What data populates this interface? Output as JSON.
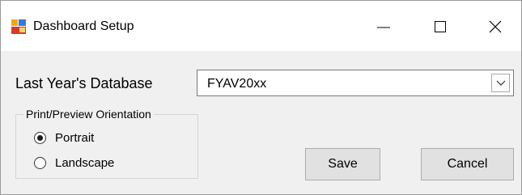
{
  "window": {
    "title": "Dashboard Setup",
    "icon": "dashboard-app-icon",
    "controls": [
      "minimize-icon",
      "maximize-icon",
      "close-icon"
    ]
  },
  "database": {
    "label": "Last Year's Database",
    "selected_value": "FYAV20xx"
  },
  "orientation": {
    "legend": "Print/Preview Orientation",
    "options": [
      {
        "label": "Portrait",
        "checked": true
      },
      {
        "label": "Landscape",
        "checked": false
      }
    ]
  },
  "buttons": {
    "save_label": "Save",
    "cancel_label": "Cancel"
  },
  "colors": {
    "titlebar": "#ffffff",
    "dialog_bg": "#f0f0f0",
    "button_bg": "#e1e1e1"
  }
}
